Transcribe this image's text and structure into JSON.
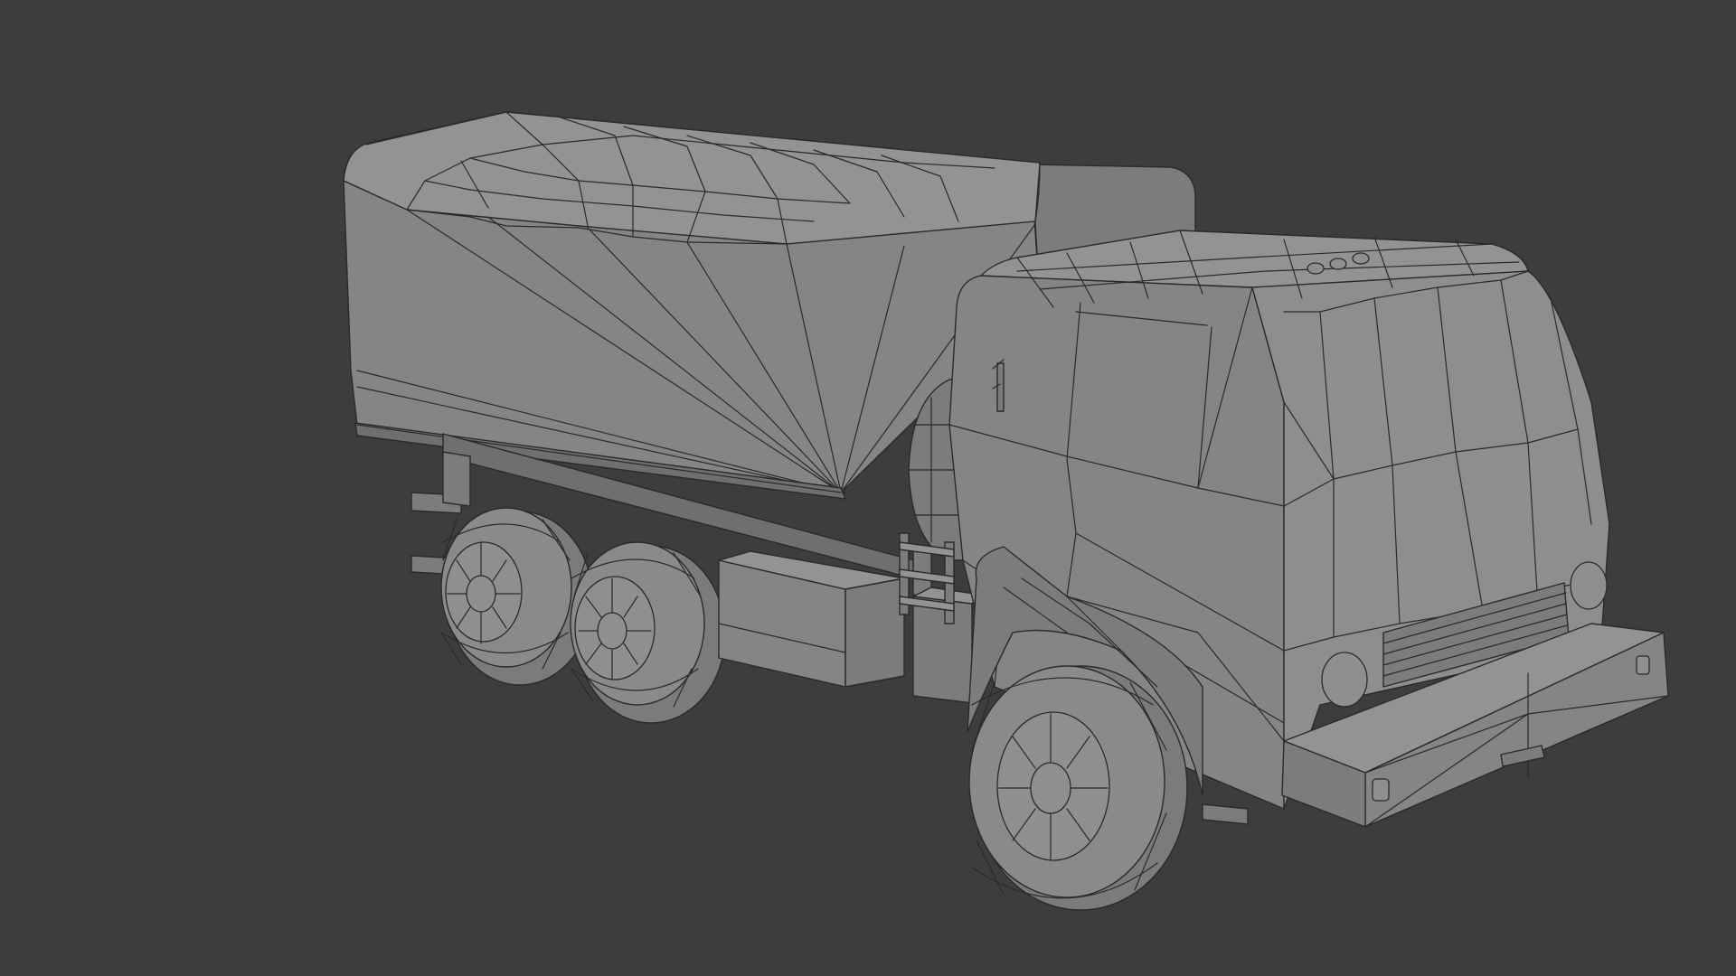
{
  "viewport": {
    "background": "#3d3d3d",
    "object": "truck",
    "shading": "solid",
    "overlay": "wireframe"
  },
  "colors": {
    "mesh_light": "#939393",
    "mesh_mid": "#858585",
    "mesh_dark": "#6f6f6f",
    "edges": "#2a2a2a"
  }
}
